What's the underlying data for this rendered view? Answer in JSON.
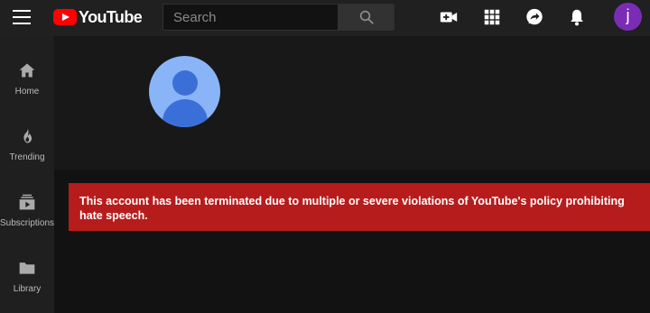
{
  "header": {
    "logo_text": "YouTube",
    "search_placeholder": "Search",
    "user_initial": "j"
  },
  "sidebar": {
    "items": [
      {
        "label": "Home",
        "icon": "home-icon"
      },
      {
        "label": "Trending",
        "icon": "flame-icon"
      },
      {
        "label": "Subscriptions",
        "icon": "subscriptions-icon"
      },
      {
        "label": "Library",
        "icon": "folder-icon"
      }
    ]
  },
  "main": {
    "termination_message": "This account has been terminated due to multiple or severe violations of YouTube's policy prohibiting hate speech."
  },
  "colors": {
    "brand_red": "#ff0000",
    "alert_red": "#b71c1c",
    "avatar_bg": "#8ab4f8",
    "user_avatar": "#7b2cb5"
  }
}
